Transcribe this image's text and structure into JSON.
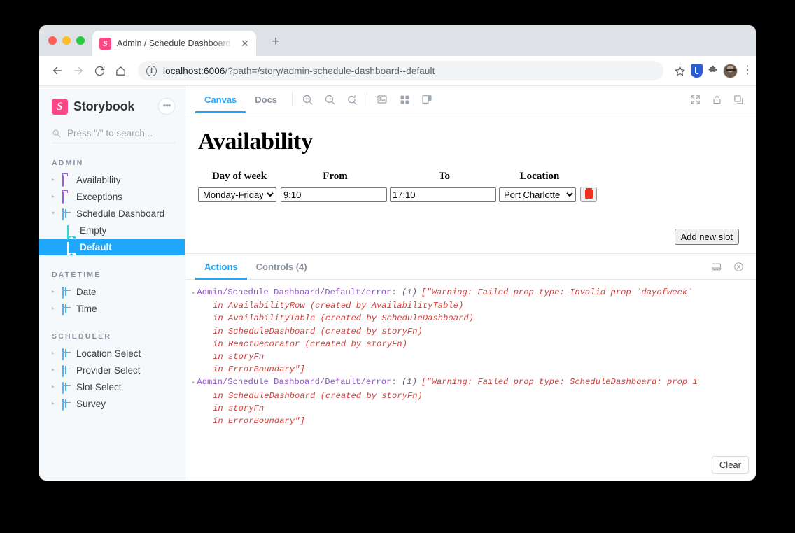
{
  "browser": {
    "tab_title": "Admin / Schedule Dashboard -",
    "tab_close_icon": "close-icon",
    "new_tab_icon": "plus-icon",
    "back_icon": "back-arrow-icon",
    "forward_icon": "forward-arrow-icon",
    "reload_icon": "reload-icon",
    "home_icon": "home-icon",
    "url_host": "localhost:6006",
    "url_path": "/?path=/story/admin-schedule-dashboard--default",
    "info_glyph": "i",
    "bookmark_icon": "star-icon",
    "extension_shield_icon": "shield-extension-icon",
    "extension_puzzle_icon": "puzzle-icon",
    "profile_icon": "avatar",
    "menu_icon": "kebab-menu-icon"
  },
  "sidebar": {
    "brand": "Storybook",
    "brand_mark": "S",
    "menu_button_label": "•••",
    "search_placeholder": "Press \"/\" to search...",
    "search_icon": "search-icon",
    "groups": [
      {
        "label": "ADMIN",
        "items": [
          {
            "label": "Availability",
            "icon": "folder-icon",
            "expandable": true,
            "selected": false,
            "depth": 0
          },
          {
            "label": "Exceptions",
            "icon": "folder-icon",
            "expandable": true,
            "selected": false,
            "depth": 0
          },
          {
            "label": "Schedule Dashboard",
            "icon": "component-icon",
            "expandable": true,
            "expanded": true,
            "selected": false,
            "depth": 0
          },
          {
            "label": "Empty",
            "icon": "story-icon",
            "expandable": false,
            "selected": false,
            "depth": 1
          },
          {
            "label": "Default",
            "icon": "story-icon",
            "expandable": false,
            "selected": true,
            "depth": 1
          }
        ]
      },
      {
        "label": "DATETIME",
        "items": [
          {
            "label": "Date",
            "icon": "component-icon",
            "expandable": true,
            "selected": false,
            "depth": 0
          },
          {
            "label": "Time",
            "icon": "component-icon",
            "expandable": true,
            "selected": false,
            "depth": 0
          }
        ]
      },
      {
        "label": "SCHEDULER",
        "items": [
          {
            "label": "Location Select",
            "icon": "component-icon",
            "expandable": true,
            "selected": false,
            "depth": 0
          },
          {
            "label": "Provider Select",
            "icon": "component-icon",
            "expandable": true,
            "selected": false,
            "depth": 0
          },
          {
            "label": "Slot Select",
            "icon": "component-icon",
            "expandable": true,
            "selected": false,
            "depth": 0
          },
          {
            "label": "Survey",
            "icon": "component-icon",
            "expandable": true,
            "selected": false,
            "depth": 0
          }
        ]
      }
    ]
  },
  "toolbar": {
    "tabs": [
      {
        "label": "Canvas",
        "active": true
      },
      {
        "label": "Docs",
        "active": false
      }
    ],
    "icons": [
      "zoom-in-icon",
      "zoom-out-icon",
      "zoom-reset-icon",
      "background-image-icon",
      "grid-icon",
      "viewport-icon"
    ],
    "right_icons": [
      "fullscreen-icon",
      "share-icon",
      "copy-icon"
    ]
  },
  "canvas": {
    "title": "Availability",
    "table": {
      "headers": [
        "Day of week",
        "From",
        "To",
        "Location"
      ],
      "row": {
        "day_of_week": "Monday-Friday",
        "day_of_week_options": [
          "Monday-Friday"
        ],
        "from": "9:10",
        "to": "17:10",
        "location": "Port Charlotte",
        "location_options": [
          "Port Charlotte"
        ],
        "delete_icon": "trash-icon"
      }
    },
    "add_button_label": "Add new slot"
  },
  "addons": {
    "tabs": [
      {
        "label": "Actions",
        "active": true
      },
      {
        "label": "Controls (4)",
        "active": false
      }
    ],
    "right_icons": [
      "dock-bottom-icon",
      "close-circle-icon"
    ],
    "clear_label": "Clear",
    "log_entries": [
      {
        "expander": "▸",
        "name": "Admin/Schedule Dashboard/Default/error",
        "count": "(1)",
        "message": "[\"Warning: Failed prop type: Invalid prop `dayofweek`",
        "stack": [
          "in AvailabilityRow (created by AvailabilityTable)",
          "in AvailabilityTable (created by ScheduleDashboard)",
          "in ScheduleDashboard (created by storyFn)",
          "in ReactDecorator (created by storyFn)",
          "in storyFn",
          "in ErrorBoundary\"]"
        ]
      },
      {
        "expander": "▸",
        "name": "Admin/Schedule Dashboard/Default/error",
        "count": "(1)",
        "message": "[\"Warning: Failed prop type: ScheduleDashboard: prop i",
        "stack": [
          "in ScheduleDashboard (created by storyFn)",
          "in storyFn",
          "in ErrorBoundary\"]"
        ]
      }
    ]
  },
  "colors": {
    "accent": "#1ea7fd",
    "brand": "#ff4785",
    "log_name": "#9254c8",
    "log_message": "#d2413c",
    "delete": "#f0301c"
  }
}
